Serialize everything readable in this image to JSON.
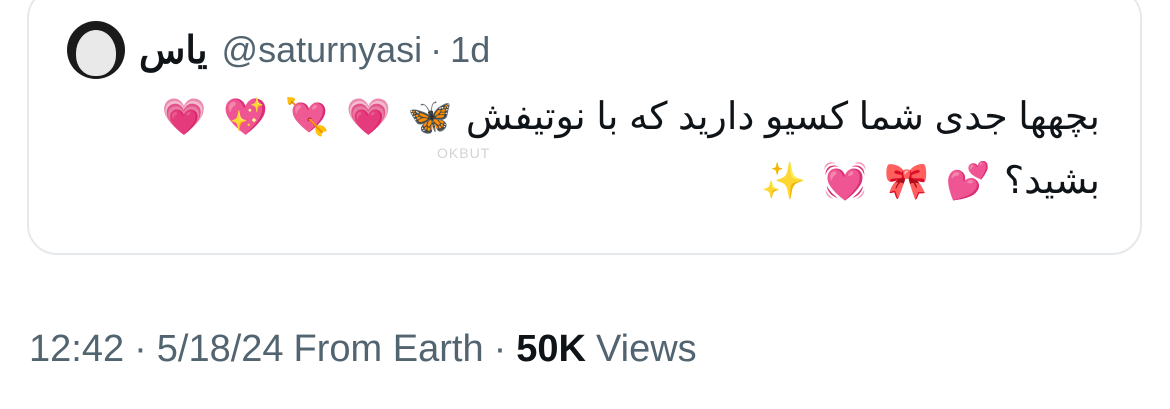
{
  "quote": {
    "display_name": "یاس",
    "handle": "@saturnyasi",
    "dot": "·",
    "age": "1d",
    "text_line1": "بچهها جدی شما کسیو دارید که با نوتیفش",
    "text_line2": "بشید؟",
    "emojis_line1": [
      "🦋",
      "💗",
      "💘",
      "💖",
      "💗"
    ],
    "emojis_line2": [
      "💕",
      "🎀",
      "💓",
      "✨"
    ],
    "watermark": "OKBUT"
  },
  "meta": {
    "time": "12:42",
    "sep1": "·",
    "date": "5/18/24",
    "source": "From Earth",
    "sep2": "·",
    "views_count": "50K",
    "views_label": "Views"
  },
  "colors": {
    "text": "#0f1419",
    "secondary": "#536471",
    "border": "#e6e9ec"
  }
}
